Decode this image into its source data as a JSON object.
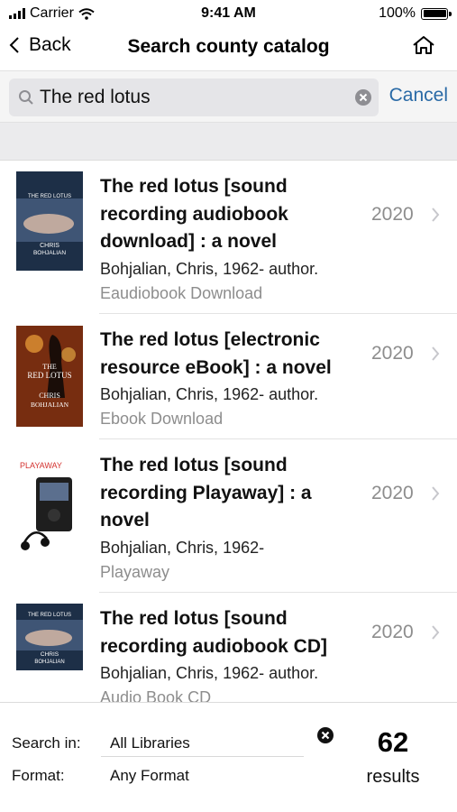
{
  "status_bar": {
    "carrier": "Carrier",
    "time": "9:41 AM",
    "battery": "100%"
  },
  "nav": {
    "back_label": "Back",
    "title": "Search county catalog",
    "home_icon": "home-icon"
  },
  "search": {
    "query": "The red lotus",
    "cancel_label": "Cancel"
  },
  "results": [
    {
      "title": "The red lotus [sound recording audiobook download] : a novel",
      "title_lines": [
        "The red lotus [sound",
        "recording audiobook",
        "download] : a novel"
      ],
      "author": "Bohjalian, Chris, 1962- author.",
      "format": "Eaudiobook Download",
      "year": "2020",
      "cover": {
        "type": "book",
        "top_text": "THE RED LOTUS",
        "author_text": "CHRIS BOHJALIAN"
      }
    },
    {
      "title": "The red lotus [electronic resource eBook] : a novel",
      "title_lines": [
        "The red lotus [electronic",
        "resource eBook] : a novel"
      ],
      "author": "Bohjalian, Chris, 1962- author.",
      "format": "Ebook Download",
      "year": "2020",
      "cover": {
        "type": "book",
        "top_text": "THE RED LOTUS",
        "author_text": "CHRIS BOHJALIAN"
      }
    },
    {
      "title": "The red lotus [sound recording Playaway] : a novel",
      "title_lines": [
        "The red lotus [sound",
        "recording Playaway] : a",
        "novel"
      ],
      "author": "Bohjalian, Chris, 1962-",
      "format": "Playaway",
      "year": "2020",
      "cover": {
        "type": "playaway",
        "brand_text": "PLAYAWAY"
      }
    },
    {
      "title": "The red lotus [sound recording audiobook CD]",
      "title_lines": [
        "The red lotus [sound",
        "recording audiobook CD]"
      ],
      "author": "Bohjalian, Chris, 1962- author.",
      "format": "Audio Book CD",
      "year": "2020",
      "cover": {
        "type": "book",
        "top_text": "THE RED LOTUS",
        "author_text": "CHRIS BOHJALIAN"
      }
    }
  ],
  "footer": {
    "search_in_label": "Search in:",
    "search_in_value": "All Libraries",
    "format_label": "Format:",
    "format_value": "Any Format",
    "count": "62",
    "count_label": "results"
  },
  "colors": {
    "accent": "#2a6aa6",
    "secondary_text": "#8d8d8d",
    "separator": "#e3e3e3"
  }
}
